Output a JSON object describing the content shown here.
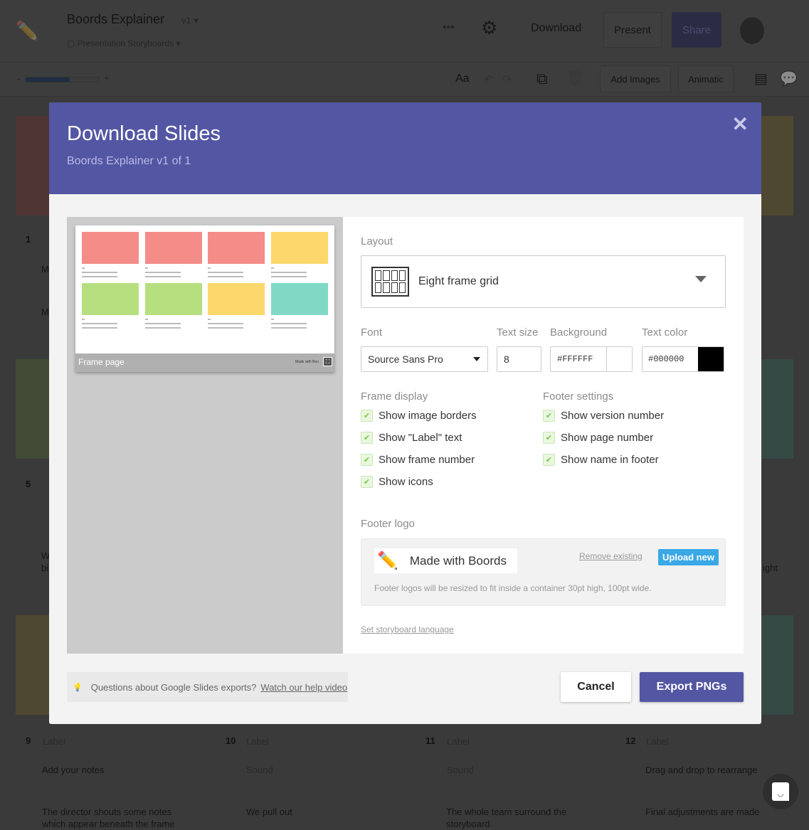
{
  "app": {
    "title": "Boords Explainer",
    "version": "v1",
    "project": "Presentation Storyboards",
    "download_label": "Download",
    "present_label": "Present",
    "share_label": "Share",
    "font_button": "Aa",
    "add_images_label": "Add Images",
    "animatic_label": "Animatic",
    "zoom_minus": "-",
    "zoom_plus": "+",
    "zoom_level": 0.7
  },
  "storyboard": {
    "frames": [
      {
        "number": "1",
        "note": "M",
        "note2": "M"
      },
      {
        "number": "5",
        "note": "W",
        "note2": "bi"
      },
      {
        "number": "9",
        "label": "Label",
        "sound": "Add your notes",
        "action": "The director shouts some notes which appear beneath the frame"
      },
      {
        "number": "10",
        "label": "Label",
        "sound": "Sound",
        "action": "We pull out"
      },
      {
        "number": "11",
        "label": "Label",
        "sound": "Sound",
        "action": "The whole team surround the storyboard"
      },
      {
        "number": "12",
        "label": "Label",
        "sound": "Drag and drop to rearrange",
        "action": "Final adjustments are made"
      }
    ],
    "right_fragment": "ight"
  },
  "modal": {
    "title": "Download Slides",
    "subtitle": "Boords Explainer v1 of 1",
    "close_icon": "close-icon",
    "preview": {
      "footer_label": "Frame page",
      "footer_logo_text": "Made with Boo",
      "thumb_colors": [
        "#f48c88",
        "#f48c88",
        "#f48c88",
        "#fcd86c",
        "#b6e07f",
        "#b6e07f",
        "#fcd86c",
        "#80d9c4"
      ]
    },
    "layout": {
      "label": "Layout",
      "value": "Eight frame grid"
    },
    "font": {
      "label": "Font",
      "value": "Source Sans Pro"
    },
    "text_size": {
      "label": "Text size",
      "value": "8"
    },
    "background": {
      "label": "Background",
      "value": "#FFFFFF",
      "swatch": "#FFFFFF"
    },
    "text_color": {
      "label": "Text color",
      "value": "#000000",
      "swatch": "#000000"
    },
    "frame_display": {
      "label": "Frame display",
      "options": [
        {
          "label": "Show image borders",
          "checked": true
        },
        {
          "label": "Show \"Label\" text",
          "checked": true
        },
        {
          "label": "Show frame number",
          "checked": true
        },
        {
          "label": "Show icons",
          "checked": true
        }
      ]
    },
    "footer_settings": {
      "label": "Footer settings",
      "options": [
        {
          "label": "Show version number",
          "checked": true
        },
        {
          "label": "Show page number",
          "checked": true
        },
        {
          "label": "Show name in footer",
          "checked": true
        }
      ]
    },
    "footer_logo": {
      "label": "Footer logo",
      "logo_text": "Made with Boords",
      "remove_label": "Remove existing",
      "upload_label": "Upload new",
      "hint": "Footer logos will be resized to fit inside a container 30pt high, 100pt wide."
    },
    "language_link": "Set storyboard language",
    "help": {
      "text": "Questions about Google Slides exports?",
      "link": "Watch our help video"
    },
    "cancel_label": "Cancel",
    "export_label": "Export PNGs",
    "colors": {
      "header": "#5356a3",
      "export": "#5356a3",
      "upload": "#3aa8e6",
      "check": "#7bc84a"
    }
  }
}
